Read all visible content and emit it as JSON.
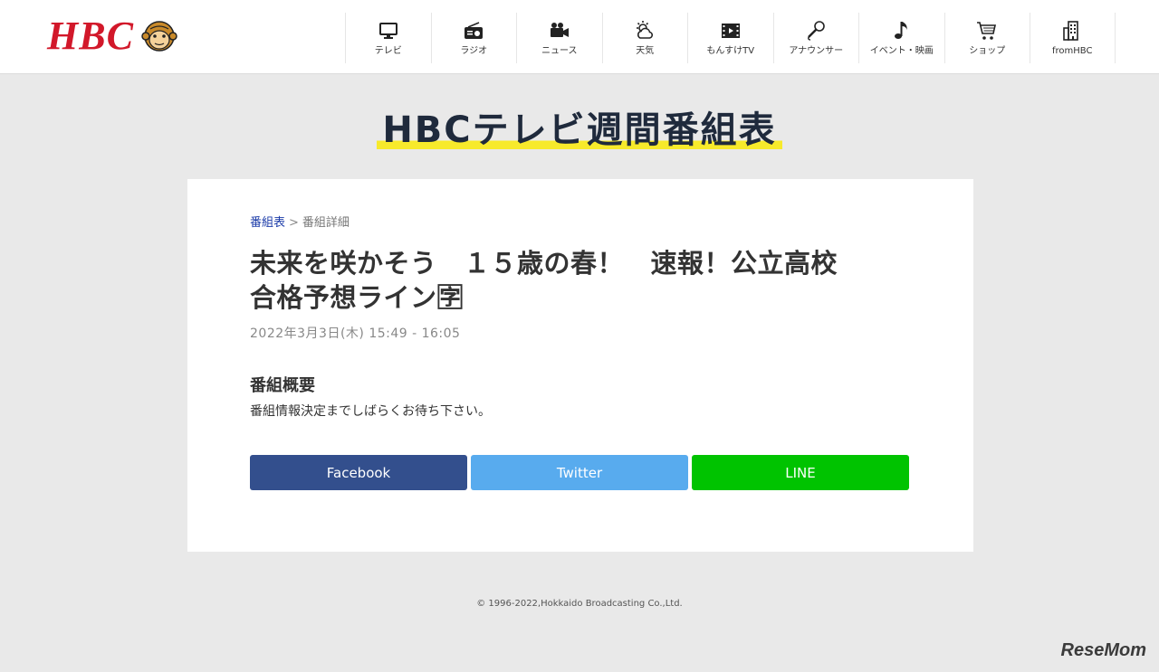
{
  "header": {
    "logo_text": "HBC",
    "nav": [
      {
        "label": "テレビ",
        "icon": "tv-icon"
      },
      {
        "label": "ラジオ",
        "icon": "radio-icon"
      },
      {
        "label": "ニュース",
        "icon": "video-camera-icon"
      },
      {
        "label": "天気",
        "icon": "weather-icon"
      },
      {
        "label": "もんすけTV",
        "icon": "film-icon"
      },
      {
        "label": "アナウンサー",
        "icon": "microphone-icon"
      },
      {
        "label": "イベント・映画",
        "icon": "music-note-icon"
      },
      {
        "label": "ショップ",
        "icon": "cart-icon"
      },
      {
        "label": "fromHBC",
        "icon": "building-icon"
      }
    ]
  },
  "page_title": "HBCテレビ週間番組表",
  "breadcrumb": {
    "link": "番組表",
    "separator": ">",
    "current": "番組詳細"
  },
  "program": {
    "title_line1": "未来を咲かそう　１５歳の春！　速報！公立高校",
    "title_line2": "合格予想ライン🈑",
    "time": "2022年3月3日(木) 15:49 - 16:05"
  },
  "summary": {
    "heading": "番組概要",
    "text": "番組情報決定までしばらくお待ち下さい。"
  },
  "share": {
    "facebook": "Facebook",
    "twitter": "Twitter",
    "line": "LINE"
  },
  "colors": {
    "brand_red": "#d2182a",
    "facebook": "#334f8d",
    "twitter": "#58abee",
    "line": "#00c300",
    "title_highlight": "#f7ea2b"
  },
  "footer": {
    "copyright": "© 1996-2022,Hokkaido Broadcasting Co.,Ltd."
  },
  "watermark": "ReseMom"
}
